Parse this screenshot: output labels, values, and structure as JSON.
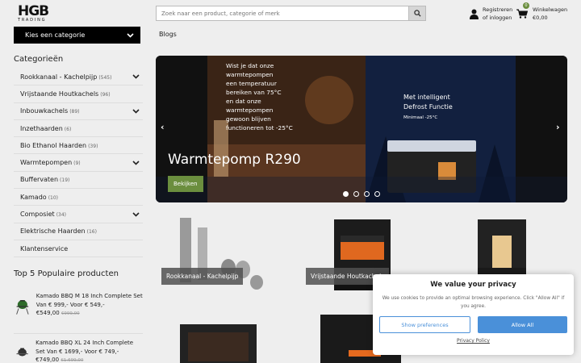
{
  "header": {
    "logo_text": "HGB",
    "logo_sub": "TRADING",
    "search_placeholder": "Zoek naar een product, categorie of merk",
    "account_line1": "Registreren",
    "account_line2": "of inloggen",
    "cart_line1": "Winkelwagen",
    "cart_line2": "€0,00",
    "cart_count": "0"
  },
  "sidebar": {
    "category_select": "Kies een categorie",
    "categories_title": "Categorieën",
    "categories": [
      {
        "label": "Rookkanaal - Kachelpijp",
        "count": "(545)",
        "expand": true
      },
      {
        "label": "Vrijstaande Houtkachels",
        "count": "(96)",
        "expand": false
      },
      {
        "label": "Inbouwkachels",
        "count": "(89)",
        "expand": true
      },
      {
        "label": "Inzethaarden",
        "count": "(6)",
        "expand": false
      },
      {
        "label": "Bio Ethanol Haarden",
        "count": "(39)",
        "expand": false
      },
      {
        "label": "Warmtepompen",
        "count": "(9)",
        "expand": true
      },
      {
        "label": "Buffervaten",
        "count": "(19)",
        "expand": false
      },
      {
        "label": "Kamado",
        "count": "(10)",
        "expand": false
      },
      {
        "label": "Composiet",
        "count": "(34)",
        "expand": true
      },
      {
        "label": "Elektrische Haarden",
        "count": "(16)",
        "expand": false
      },
      {
        "label": "Klantenservice",
        "count": "",
        "expand": false
      }
    ],
    "top5_title": "Top 5 Populaire producten",
    "products": [
      {
        "name": "Kamado BBQ M 18 Inch Complete Set Van € 999,- Voor € 549,-",
        "price": "€549,00",
        "old": "€999,00"
      },
      {
        "name": "Kamado BBQ XL 24 Inch Complete Set Van € 1699,- Voor € 749,-",
        "price": "€749,00",
        "old": "€1.699,00"
      }
    ]
  },
  "main": {
    "breadcrumb": "Blogs",
    "hero": {
      "title": "Warmtepomp R290",
      "button": "Bekijken",
      "left_caption": [
        "Wist je dat onze",
        "warmtepompen",
        "een temperatuur",
        "bereiken van 75°C",
        "en dat onze",
        "warmtepompen",
        "gewoon blijven",
        "functioneren tot -25°C"
      ],
      "right_caption_1": "Met intelligent",
      "right_caption_2": "Defrost Functie",
      "right_caption_3": "Minimaal -25°C"
    },
    "tiles": [
      "Rookkanaal - Kachelpijp",
      "Vrijstaande Houtkachels",
      ""
    ]
  },
  "cookie": {
    "title": "We value your privacy",
    "text": "We use cookies to provide an optimal browsing experience. Click \"Allow All\" if you agree.",
    "show_prefs": "Show preferences",
    "allow_all": "Allow All",
    "policy": "Privacy Policy"
  }
}
